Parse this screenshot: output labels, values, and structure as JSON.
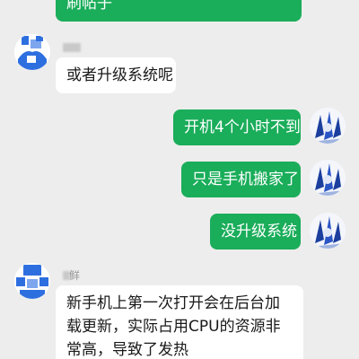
{
  "conversation": {
    "messages": [
      {
        "id": "m0",
        "direction": "outgoing",
        "text": "刷帖子"
      },
      {
        "id": "m1",
        "direction": "incoming",
        "sender_name": "",
        "text": "或者升级系统呢"
      },
      {
        "id": "m2",
        "direction": "outgoing",
        "text": "开机4个小时不到"
      },
      {
        "id": "m3",
        "direction": "outgoing",
        "text": "只是手机搬家了"
      },
      {
        "id": "m4",
        "direction": "outgoing",
        "text": "没升级系统"
      },
      {
        "id": "m5",
        "direction": "incoming",
        "sender_name": "鲜",
        "text": "新手机上第一次打开会在后台加载更新，实际占用CPU的资源非常高，导致了发热"
      }
    ]
  },
  "icons": {
    "incoming_avatar": "user-avatar-icon",
    "outgoing_avatar": "user-photo-avatar"
  },
  "colors": {
    "background": "#ededed",
    "outgoing_bubble": "#1aad5a",
    "incoming_bubble": "#ffffff",
    "incoming_avatar_blue": "#2e6fe0"
  }
}
